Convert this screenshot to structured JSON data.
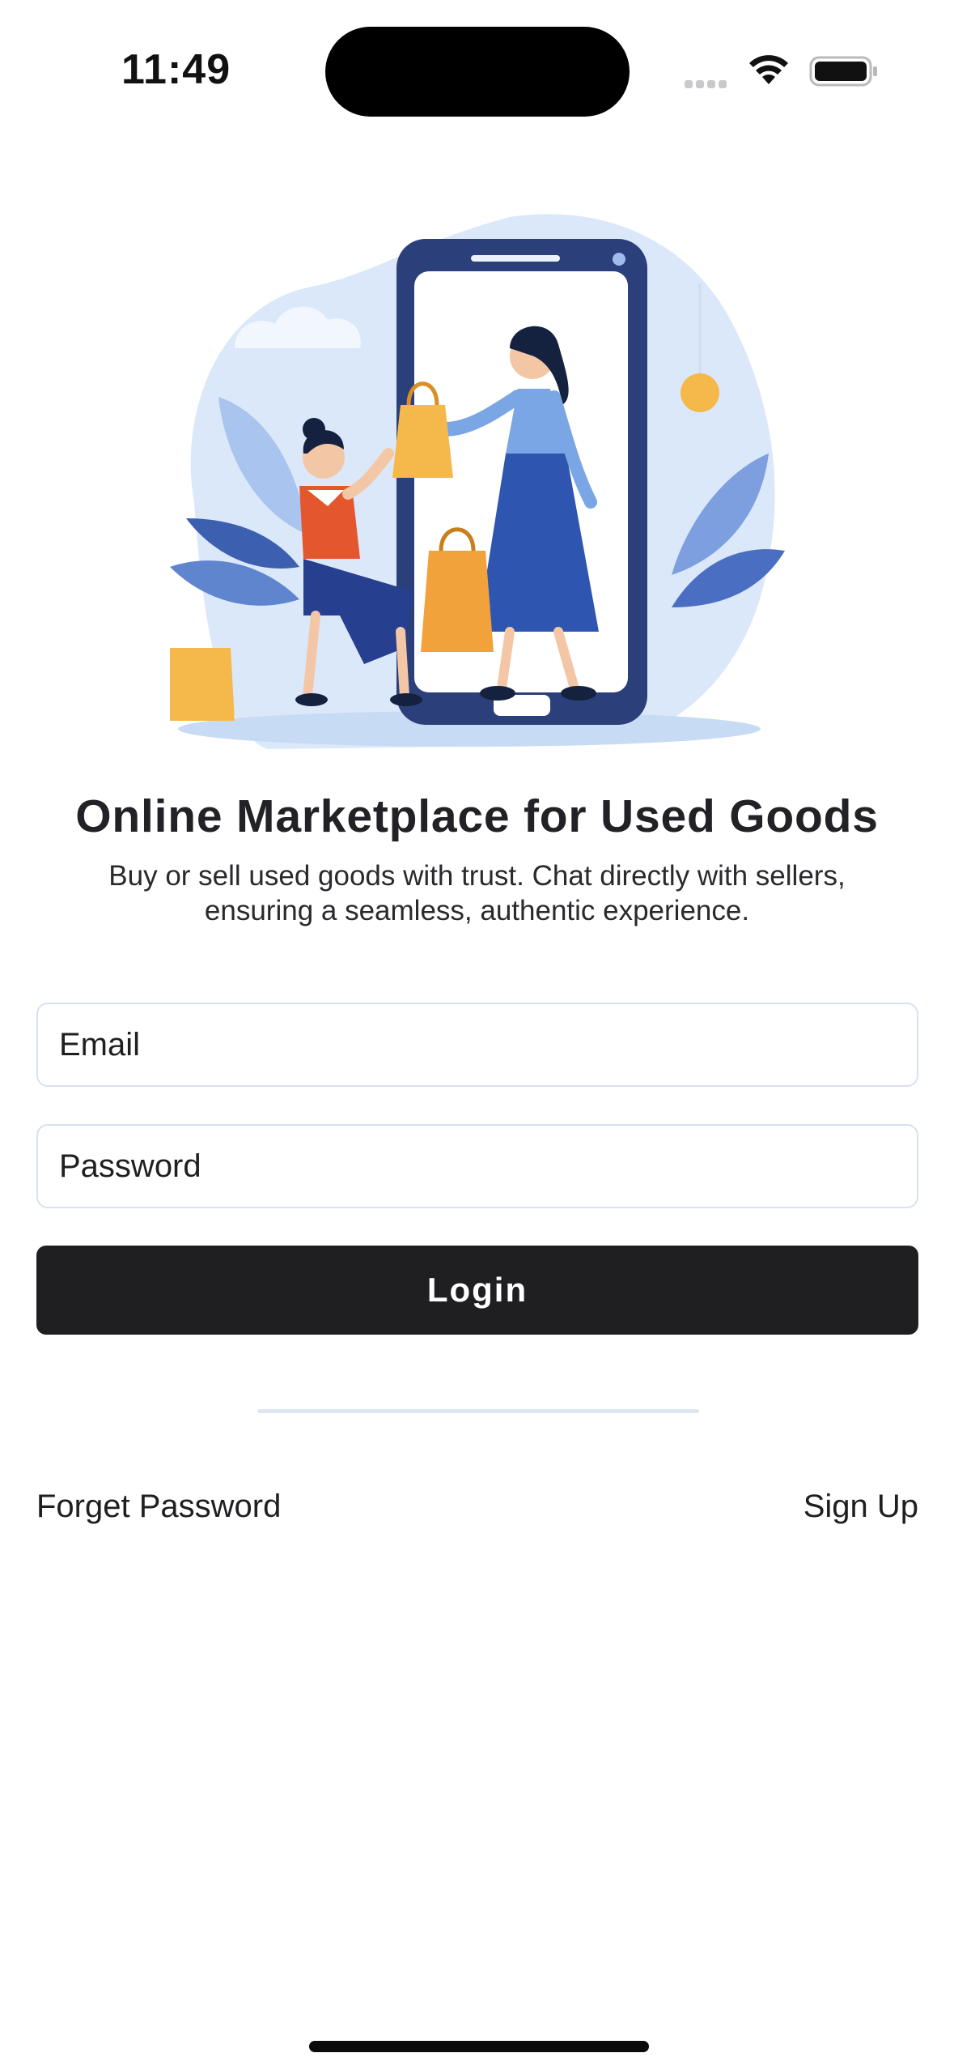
{
  "status_bar": {
    "time": "11:49",
    "icons": [
      "cellular-signal-icon",
      "wifi-icon",
      "battery-icon"
    ]
  },
  "hero": {
    "illustration": "shopping-illustration"
  },
  "header": {
    "title": "Online Marketplace for Used Goods",
    "subtitle_line1": "Buy or sell used goods with trust. Chat directly with sellers,",
    "subtitle_line2": "ensuring a seamless, authentic experience."
  },
  "form": {
    "email_placeholder": "Email",
    "password_placeholder": "Password",
    "login_label": "Login"
  },
  "links": {
    "forget_password": "Forget Password",
    "sign_up": "Sign Up"
  },
  "colors": {
    "primary_button": "#1f1f21",
    "field_border": "#d6e2ef",
    "illustration_blue": "#2b3f7a",
    "bag_orange": "#f5b84a"
  }
}
